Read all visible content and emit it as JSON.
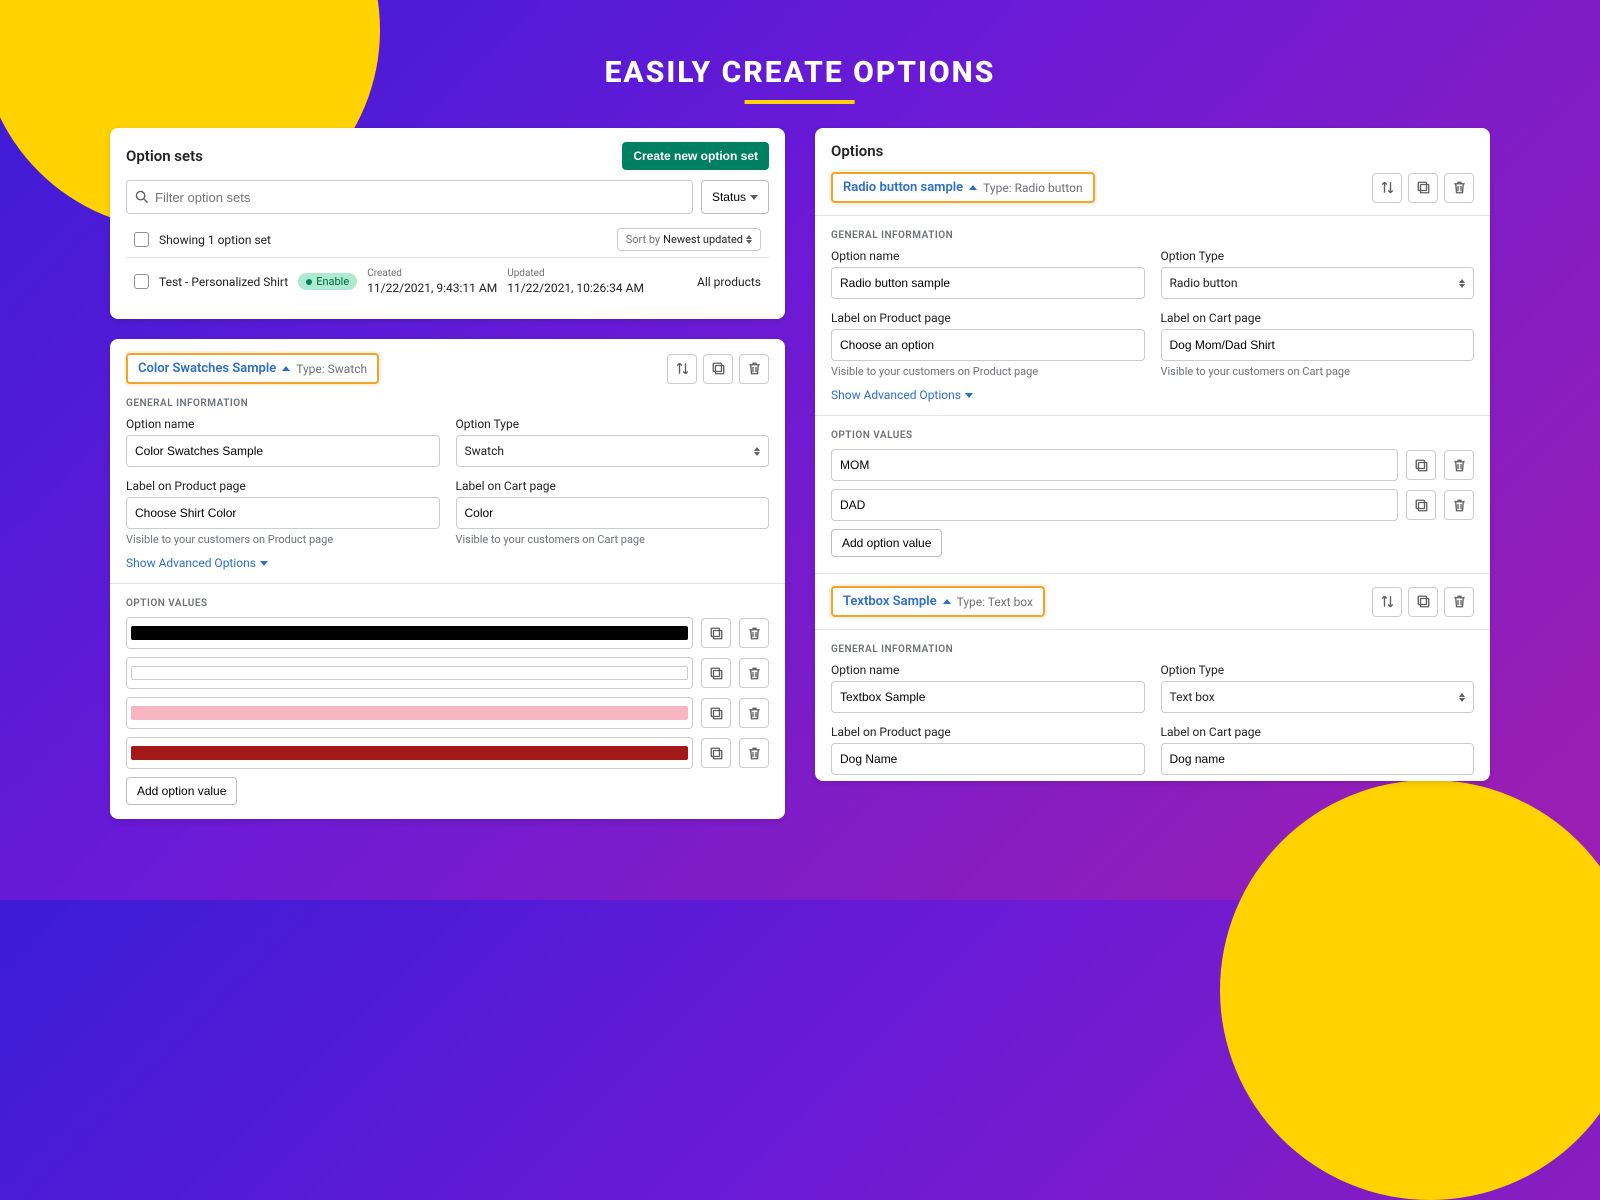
{
  "hero": {
    "title": "EASILY CREATE OPTIONS"
  },
  "labels": {
    "general_info": "GENERAL INFORMATION",
    "option_values": "OPTION VALUES",
    "option_name": "Option name",
    "option_type": "Option Type",
    "label_product": "Label on Product page",
    "label_cart": "Label on Cart page",
    "help_product": "Visible to your customers on Product page",
    "help_cart": "Visible to your customers on Cart page",
    "advanced": "Show Advanced Options",
    "add_value": "Add option value",
    "type_prefix": "Type:"
  },
  "sets_panel": {
    "title": "Option sets",
    "create_btn": "Create new option set",
    "search_placeholder": "Filter option sets",
    "status_btn": "Status",
    "showing": "Showing 1 option set",
    "sort_prefix": "Sort by",
    "sort_value": "Newest updated",
    "row": {
      "name": "Test - Personalized Shirt",
      "badge": "Enable",
      "created_label": "Created",
      "created_value": "11/22/2021, 9:43:11 AM",
      "updated_label": "Updated",
      "updated_value": "11/22/2021, 10:26:34 AM",
      "scope": "All products"
    }
  },
  "swatches_panel": {
    "pill_title": "Color Swatches Sample",
    "pill_type": "Swatch",
    "name": "Color Swatches Sample",
    "type": "Swatch",
    "label_product": "Choose Shirt Color",
    "label_cart": "Color",
    "swatches": [
      {
        "color": "#000000"
      },
      {
        "color": "#ffffff",
        "border": "#c9cccf"
      },
      {
        "color": "#f7b6c1"
      },
      {
        "color": "#a31818"
      }
    ]
  },
  "options_panel": {
    "title": "Options",
    "radio": {
      "pill_title": "Radio button sample",
      "pill_type": "Radio button",
      "name": "Radio button sample",
      "type": "Radio button",
      "label_product": "Choose an option",
      "label_cart": "Dog Mom/Dad Shirt",
      "values": [
        "MOM",
        "DAD"
      ]
    },
    "textbox": {
      "pill_title": "Textbox Sample",
      "pill_type": "Text box",
      "name": "Textbox Sample",
      "type": "Text box",
      "label_product": "Dog Name",
      "label_cart": "Dog name"
    }
  }
}
